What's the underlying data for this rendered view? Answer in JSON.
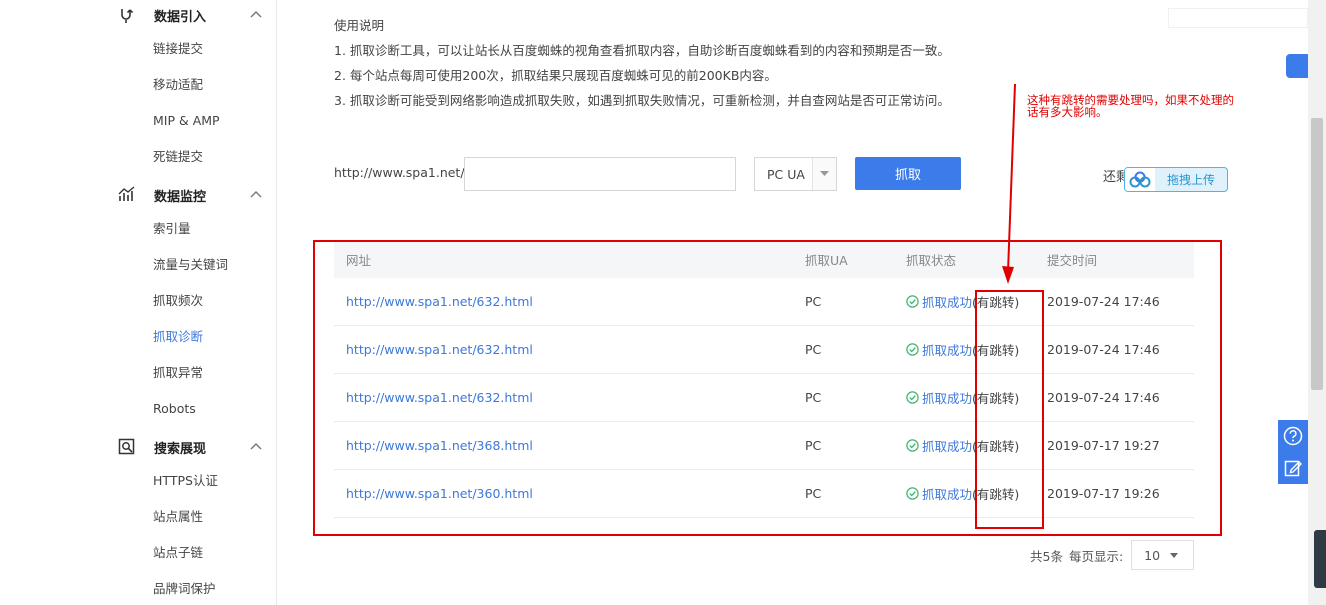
{
  "sidebar": {
    "groups": [
      {
        "title": "数据引入",
        "icon": "data-import-icon",
        "items": [
          "链接提交",
          "移动适配",
          "MIP & AMP",
          "死链提交"
        ]
      },
      {
        "title": "数据监控",
        "icon": "data-monitor-icon",
        "items": [
          "索引量",
          "流量与关键词",
          "抓取频次",
          "抓取诊断",
          "抓取异常",
          "Robots"
        ]
      },
      {
        "title": "搜索展现",
        "icon": "search-display-icon",
        "items": [
          "HTTPS认证",
          "站点属性",
          "站点子链",
          "品牌词保护"
        ]
      }
    ],
    "active_item": "抓取诊断"
  },
  "instructions": {
    "title": "使用说明",
    "lines": [
      "1. 抓取诊断工具，可以让站长从百度蜘蛛的视角查看抓取内容，自助诊断百度蜘蛛看到的内容和预期是否一致。",
      "2. 每个站点每周可使用200次，抓取结果只展现百度蜘蛛可见的前200KB内容。",
      "3. 抓取诊断可能受到网络影响造成抓取失败，如遇到抓取失败情况，可重新检测，并自查网站是否可正常访问。"
    ]
  },
  "fetch_form": {
    "url_prefix": "http://www.spa1.net/",
    "url_value": "",
    "ua_selected": "PC UA",
    "fetch_button": "抓取",
    "also_text": "还剩",
    "upload_label": "拖拽上传"
  },
  "annotation": {
    "text": "这种有跳转的需要处理吗，如果不处理的话有多大影响。"
  },
  "table": {
    "headers": {
      "url": "网址",
      "ua": "抓取UA",
      "status": "抓取状态",
      "time": "提交时间"
    },
    "rows": [
      {
        "url": "http://www.spa1.net/632.html",
        "ua": "PC",
        "status": "抓取成功",
        "jump": "(有跳转)",
        "time": "2019-07-24 17:46"
      },
      {
        "url": "http://www.spa1.net/632.html",
        "ua": "PC",
        "status": "抓取成功",
        "jump": "(有跳转)",
        "time": "2019-07-24 17:46"
      },
      {
        "url": "http://www.spa1.net/632.html",
        "ua": "PC",
        "status": "抓取成功",
        "jump": "(有跳转)",
        "time": "2019-07-24 17:46"
      },
      {
        "url": "http://www.spa1.net/368.html",
        "ua": "PC",
        "status": "抓取成功",
        "jump": "(有跳转)",
        "time": "2019-07-17 19:27"
      },
      {
        "url": "http://www.spa1.net/360.html",
        "ua": "PC",
        "status": "抓取成功",
        "jump": "(有跳转)",
        "time": "2019-07-17 19:26"
      }
    ]
  },
  "pagination": {
    "total": "共5条",
    "per_page_label": "每页显示:",
    "per_page_value": "10"
  },
  "colors": {
    "accent": "#3c7cea",
    "link": "#3d78d8",
    "annotation_red": "#e00000",
    "success_green": "#3cb371"
  }
}
